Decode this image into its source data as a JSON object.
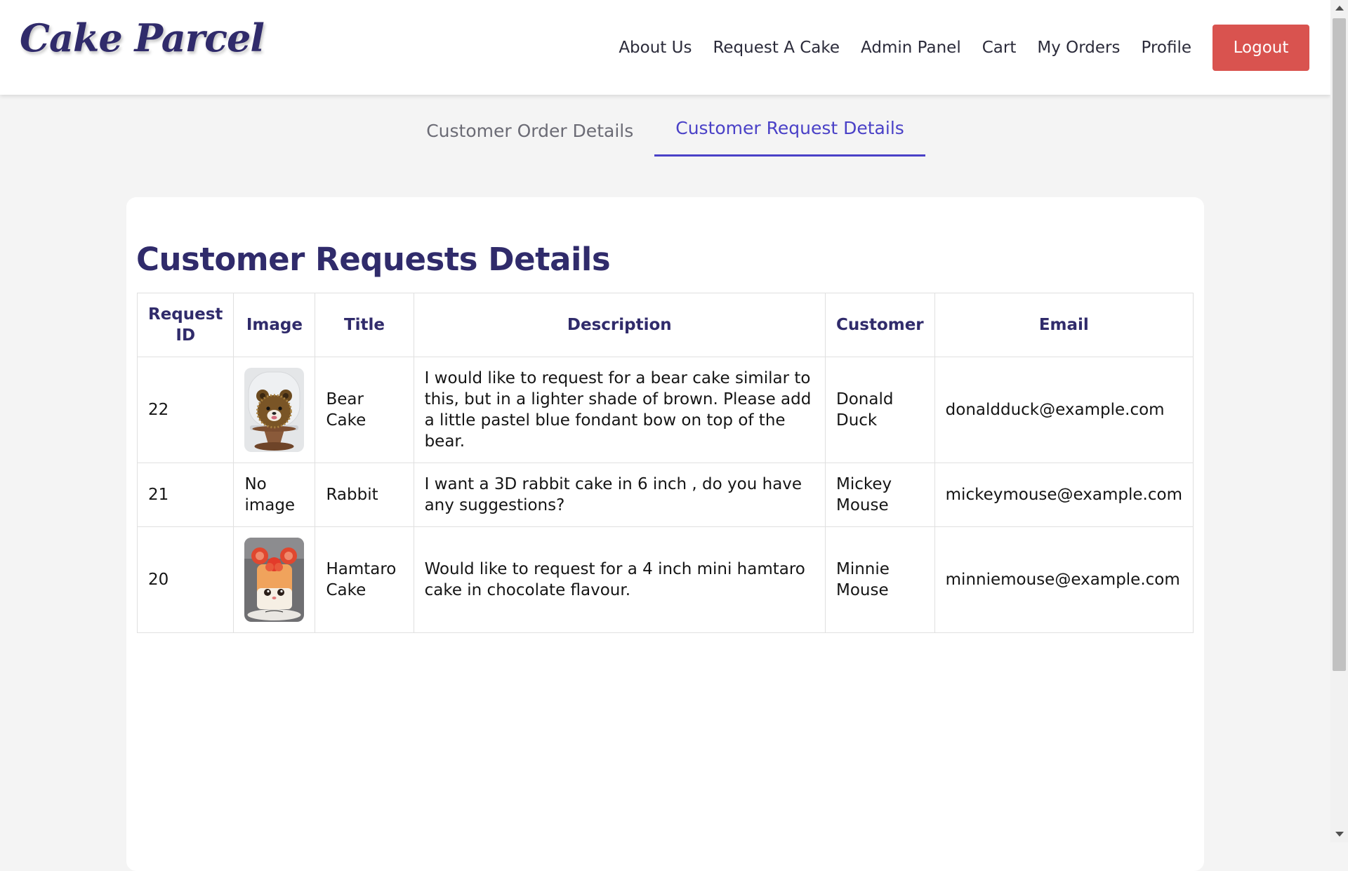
{
  "header": {
    "logo": "Cake Parcel",
    "nav": [
      "About Us",
      "Request A Cake",
      "Admin Panel",
      "Cart",
      "My Orders",
      "Profile"
    ],
    "logout_label": "Logout"
  },
  "tabs": [
    {
      "label": "Customer Order Details",
      "active": false
    },
    {
      "label": "Customer Request Details",
      "active": true
    }
  ],
  "colors": {
    "brand": "#302b6b",
    "accent": "#4a41c7",
    "logout": "#d9534f"
  },
  "main": {
    "title": "Customer Requests Details",
    "table": {
      "columns": [
        "Request ID",
        "Image",
        "Title",
        "Description",
        "Customer",
        "Email"
      ],
      "rows": [
        {
          "id": "22",
          "image": "bear-cake-photo",
          "image_text": "",
          "title": "Bear Cake",
          "description": "I would like to request for a bear cake similar to this, but in a lighter shade of brown. Please add a little pastel blue fondant bow on top of the bear.",
          "customer": "Donald Duck",
          "email": "donaldduck@example.com"
        },
        {
          "id": "21",
          "image": "",
          "image_text": "No image",
          "title": "Rabbit",
          "description": "I want a 3D rabbit cake in 6 inch , do you have any suggestions?",
          "customer": "Mickey Mouse",
          "email": "mickeymouse@example.com"
        },
        {
          "id": "20",
          "image": "hamtaro-cake-photo",
          "image_text": "",
          "title": "Hamtaro Cake",
          "description": "Would like to request for a 4 inch mini hamtaro cake in chocolate flavour.",
          "customer": "Minnie Mouse",
          "email": "minniemouse@example.com"
        }
      ]
    }
  }
}
